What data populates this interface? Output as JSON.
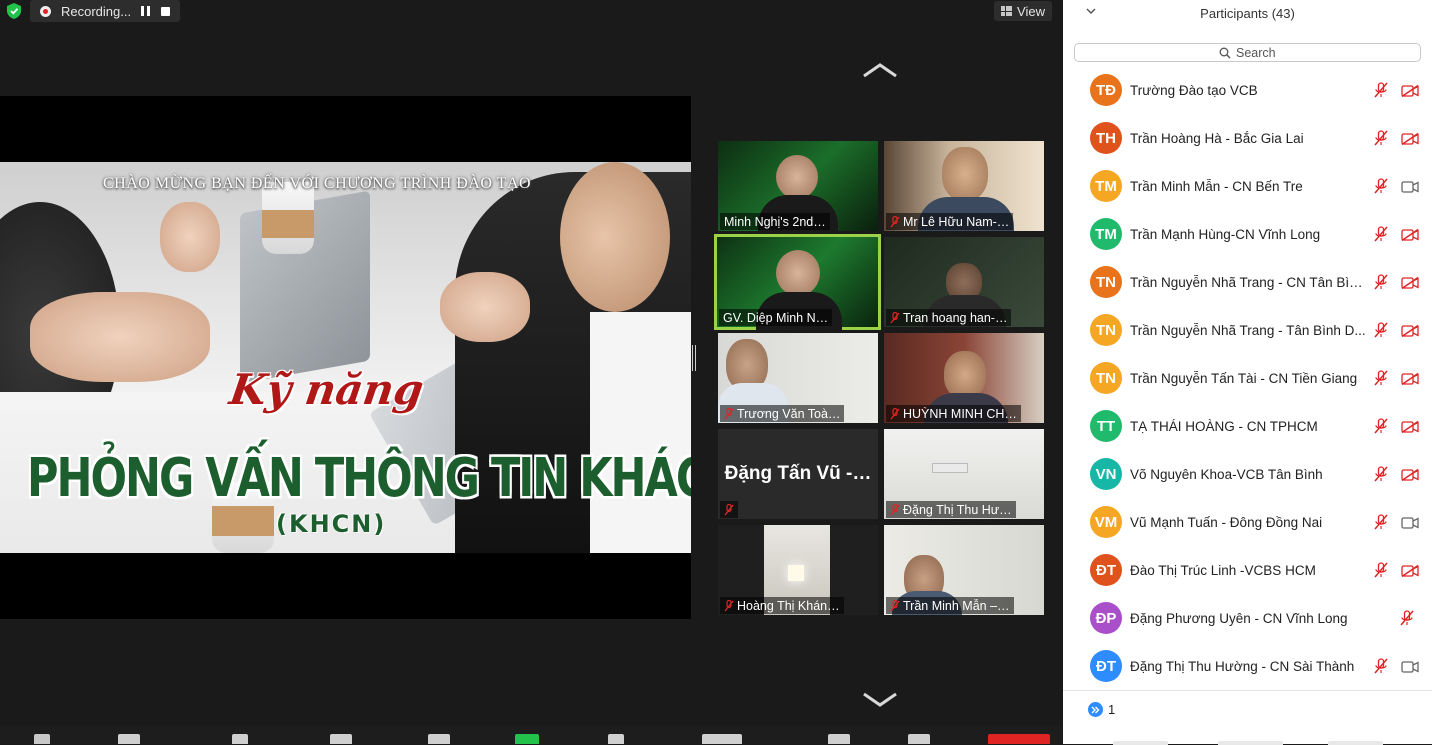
{
  "window": {
    "recording_label": "Recording...",
    "view_label": "View"
  },
  "slide": {
    "welcome": "CHÀO MỪNG BẠN ĐẾN VỚI CHƯƠNG TRÌNH ĐÀO TẠO",
    "skill": "Kỹ năng",
    "title": "PHỎNG VẤN THÔNG TIN KHÁCH HÀNG",
    "subtitle": "(KHCN)"
  },
  "gallery": {
    "tiles": [
      {
        "name": "Minh Nghị's 2nd…",
        "muted": false,
        "active": false
      },
      {
        "name": "Mr Lê Hữu Nam-…",
        "muted": true,
        "active": false
      },
      {
        "name": "GV. Diệp Minh N…",
        "muted": false,
        "active": true
      },
      {
        "name": "Tran hoang han-…",
        "muted": true,
        "active": false
      },
      {
        "name": "Trương Văn Toà…",
        "muted": true,
        "active": false
      },
      {
        "name": "HUỲNH MINH CH…",
        "muted": true,
        "active": false
      },
      {
        "name": "Đặng Tấn Vũ -…",
        "muted": true,
        "active": false,
        "no_video": true
      },
      {
        "name": "Đặng Thị Thu Hư…",
        "muted": true,
        "active": false
      },
      {
        "name": "Hoàng Thị Khán…",
        "muted": true,
        "active": false
      },
      {
        "name": "Trần Minh Mẫn –…",
        "muted": true,
        "active": false
      }
    ]
  },
  "participants": {
    "header": "Participants (43)",
    "search_placeholder": "Search",
    "list": [
      {
        "initials": "TĐ",
        "name": "Trường Đào tạo VCB",
        "color": "#e8731a",
        "video": "off"
      },
      {
        "initials": "TH",
        "name": "Trần Hoàng Hà - Bắc Gia Lai",
        "color": "#e0521c",
        "video": "off"
      },
      {
        "initials": "TM",
        "name": "Trần Minh Mẫn - CN Bến Tre",
        "color": "#f5a623",
        "video": "on"
      },
      {
        "initials": "TM",
        "name": "Trần Mạnh Hùng-CN Vĩnh Long",
        "color": "#1fba6b",
        "video": "off"
      },
      {
        "initials": "TN",
        "name": "Trần Nguyễn Nhã Trang - CN Tân Bìn...",
        "color": "#e8731a",
        "video": "off"
      },
      {
        "initials": "TN",
        "name": "Trần Nguyễn Nhã Trang - Tân Bình D...",
        "color": "#f5a623",
        "video": "off"
      },
      {
        "initials": "TN",
        "name": "Trần Nguyễn Tấn Tài - CN Tiền Giang",
        "color": "#f5a623",
        "video": "off"
      },
      {
        "initials": "TT",
        "name": "TẠ THÁI HOÀNG - CN TPHCM",
        "color": "#1fba6b",
        "video": "off"
      },
      {
        "initials": "VN",
        "name": "Võ Nguyên Khoa-VCB Tân Bình",
        "color": "#17b7a8",
        "video": "off"
      },
      {
        "initials": "VM",
        "name": "Vũ Mạnh Tuấn - Đông Đồng Nai",
        "color": "#f5a623",
        "video": "on"
      },
      {
        "initials": "ĐT",
        "name": "Đào Thị Trúc Linh -VCBS HCM",
        "color": "#e0521c",
        "video": "off"
      },
      {
        "initials": "ĐP",
        "name": "Đặng Phương Uyên - CN Vĩnh Long",
        "color": "#a94fc9",
        "video": "none"
      },
      {
        "initials": "ĐT",
        "name": "Đặng Thị Thu Hường - CN Sài Thành",
        "color": "#2d8cff",
        "video": "on"
      }
    ],
    "raised_hands_count": "1"
  },
  "colors": {
    "mute_red": "#e02424",
    "active_speaker": "#9bd248",
    "raise_blue": "#2d8cff",
    "slide_green": "#1d5e2e",
    "slide_red": "#b01818"
  }
}
